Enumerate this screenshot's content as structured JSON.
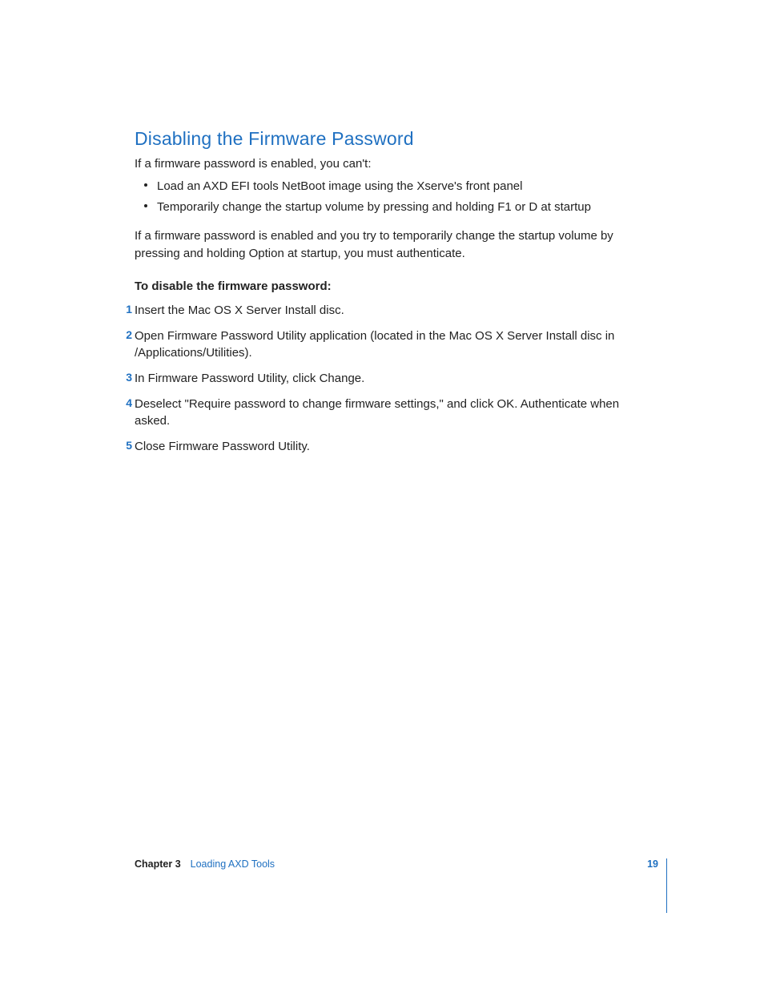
{
  "heading": "Disabling the Firmware Password",
  "intro": "If a firmware password is enabled, you can't:",
  "bullets": [
    "Load an AXD EFI tools NetBoot image using the Xserve's front panel",
    "Temporarily change the startup volume by pressing and holding F1 or D at startup"
  ],
  "note": "If a firmware password is enabled and you try to temporarily change the startup volume by pressing and holding Option at startup, you must authenticate.",
  "steps_title": "To disable the firmware password:",
  "steps": [
    {
      "n": "1",
      "t": "Insert the Mac OS X Server Install disc."
    },
    {
      "n": "2",
      "t": "Open Firmware Password Utility application (located in the Mac OS X Server Install disc in /Applications/Utilities)."
    },
    {
      "n": "3",
      "t": "In Firmware Password Utility, click Change."
    },
    {
      "n": "4",
      "t": "Deselect \"Require password to change firmware settings,\" and click OK. Authenticate when asked."
    },
    {
      "n": "5",
      "t": "Close Firmware Password Utility."
    }
  ],
  "footer": {
    "chapter": "Chapter 3",
    "title": "Loading AXD Tools",
    "page": "19"
  }
}
